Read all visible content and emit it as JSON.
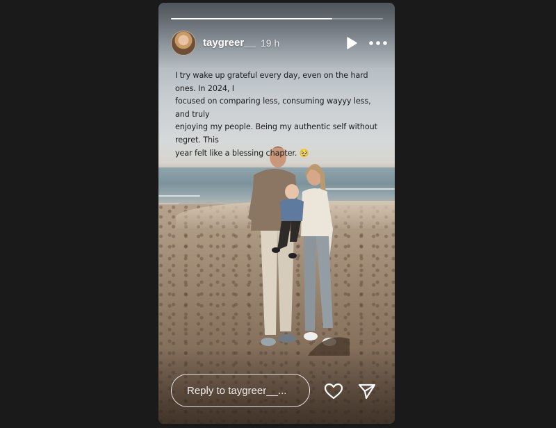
{
  "story": {
    "progress": 0.76,
    "username": "taygreer__",
    "time_ago": "19 h",
    "caption_lines": [
      "I try wake up grateful every day, even on the hard ones. In 2024, I",
      "focused on comparing less, consuming wayyy less, and truly",
      "enjoying my people. Being my authentic self without regret. This",
      "year felt like a blessing chapter. 🥹"
    ]
  },
  "controls": {
    "play_icon": "play-icon",
    "more_icon": "more-options-icon",
    "like_icon": "heart-icon",
    "share_icon": "send-icon"
  },
  "reply": {
    "placeholder": "Reply to taygreer__..."
  },
  "colors": {
    "background": "#1a1a1a",
    "text_on_photo": "#ffffff",
    "caption_text": "#1b1b1b"
  }
}
